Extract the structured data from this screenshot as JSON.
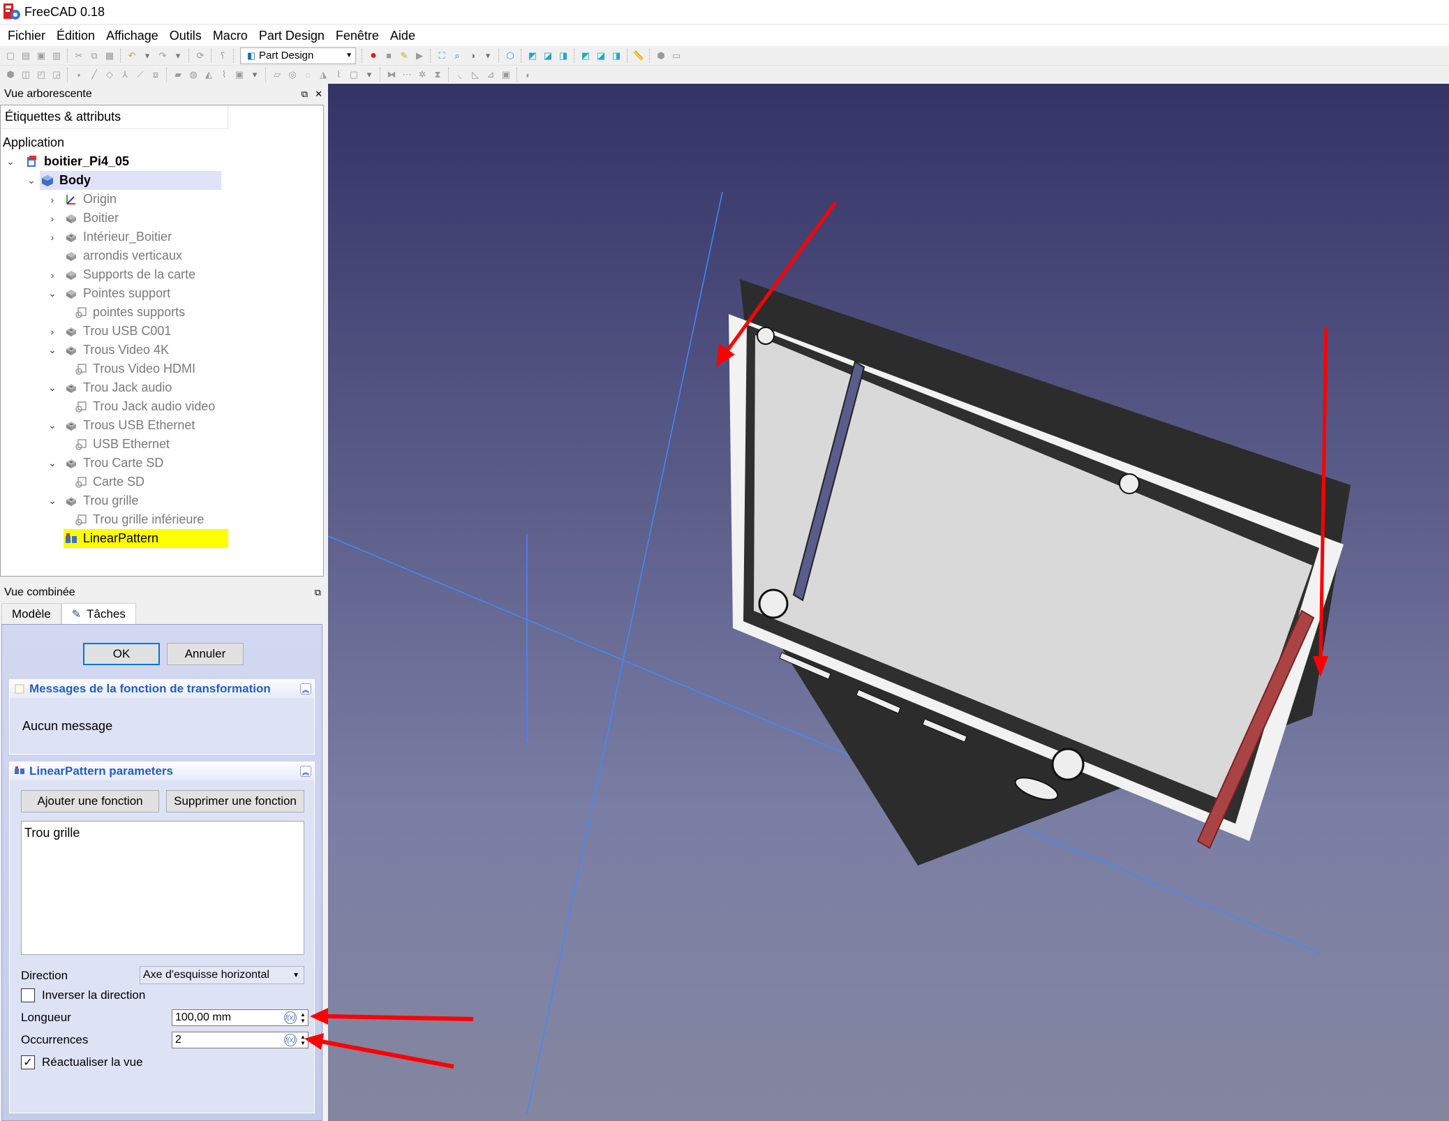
{
  "window": {
    "title": "FreeCAD 0.18"
  },
  "menubar": [
    "Fichier",
    "Édition",
    "Affichage",
    "Outils",
    "Macro",
    "Part Design",
    "Fenêtre",
    "Aide"
  ],
  "toolbar": {
    "workbench": "Part Design"
  },
  "tree": {
    "header": "Vue arborescente",
    "column": "Étiquettes & attributs",
    "group": "Application",
    "document": "boitier_Pi4_05",
    "body": "Body",
    "items": [
      {
        "label": "Origin",
        "level": 2,
        "caret": ">",
        "icon": "origin-icon"
      },
      {
        "label": "Boitier",
        "level": 2,
        "caret": ">",
        "icon": "pad-icon"
      },
      {
        "label": "Intérieur_Boitier",
        "level": 2,
        "caret": ">",
        "icon": "pocket-icon"
      },
      {
        "label": "arrondis verticaux",
        "level": 2,
        "caret": "",
        "icon": "fillet-icon"
      },
      {
        "label": "Supports de la carte",
        "level": 2,
        "caret": ">",
        "icon": "pad-icon"
      },
      {
        "label": "Pointes support",
        "level": 2,
        "caret": "v",
        "icon": "pad-icon"
      },
      {
        "label": "pointes supports",
        "level": 3,
        "caret": "",
        "icon": "sketch-icon"
      },
      {
        "label": "Trou USB C001",
        "level": 2,
        "caret": ">",
        "icon": "pocket-icon"
      },
      {
        "label": "Trous Video 4K",
        "level": 2,
        "caret": "v",
        "icon": "pocket-icon"
      },
      {
        "label": "Trous Video HDMI",
        "level": 3,
        "caret": "",
        "icon": "sketch-icon"
      },
      {
        "label": "Trou Jack audio",
        "level": 2,
        "caret": "v",
        "icon": "pocket-icon"
      },
      {
        "label": "Trou Jack audio video",
        "level": 3,
        "caret": "",
        "icon": "sketch-icon"
      },
      {
        "label": "Trous USB Ethernet",
        "level": 2,
        "caret": "v",
        "icon": "pocket-icon"
      },
      {
        "label": "USB Ethernet",
        "level": 3,
        "caret": "",
        "icon": "sketch-icon"
      },
      {
        "label": "Trou Carte SD",
        "level": 2,
        "caret": "v",
        "icon": "pocket-icon"
      },
      {
        "label": "Carte SD",
        "level": 3,
        "caret": "",
        "icon": "sketch-icon"
      },
      {
        "label": "Trou grille",
        "level": 2,
        "caret": "v",
        "icon": "pocket-icon"
      },
      {
        "label": "Trou grille inférieure",
        "level": 3,
        "caret": "",
        "icon": "sketch-icon"
      },
      {
        "label": "LinearPattern",
        "level": 2,
        "caret": "",
        "icon": "linear-pattern-icon",
        "highlight": true
      }
    ]
  },
  "combo": {
    "header": "Vue combinée",
    "tabs": [
      "Modèle",
      "Tâches"
    ],
    "ok": "OK",
    "cancel": "Annuler",
    "messages": {
      "title": "Messages de la fonction de transformation",
      "text": "Aucun message"
    },
    "params": {
      "title": "LinearPattern parameters",
      "add": "Ajouter une fonction",
      "remove": "Supprimer une fonction",
      "features": [
        "Trou grille"
      ],
      "direction_label": "Direction",
      "direction_value": "Axe d'esquisse horizontal",
      "reverse_label": "Inverser la direction",
      "reverse_checked": false,
      "length_label": "Longueur",
      "length_value": "100,00 mm",
      "occurrences_label": "Occurrences",
      "occurrences_value": "2",
      "refresh_label": "Réactualiser la vue",
      "refresh_checked": true
    }
  },
  "colors": {
    "viewport_top": "#333366",
    "viewport_bottom": "#84869f",
    "highlight": "#ffff00",
    "accent": "#215dc6",
    "arrow": "#ff0000"
  }
}
